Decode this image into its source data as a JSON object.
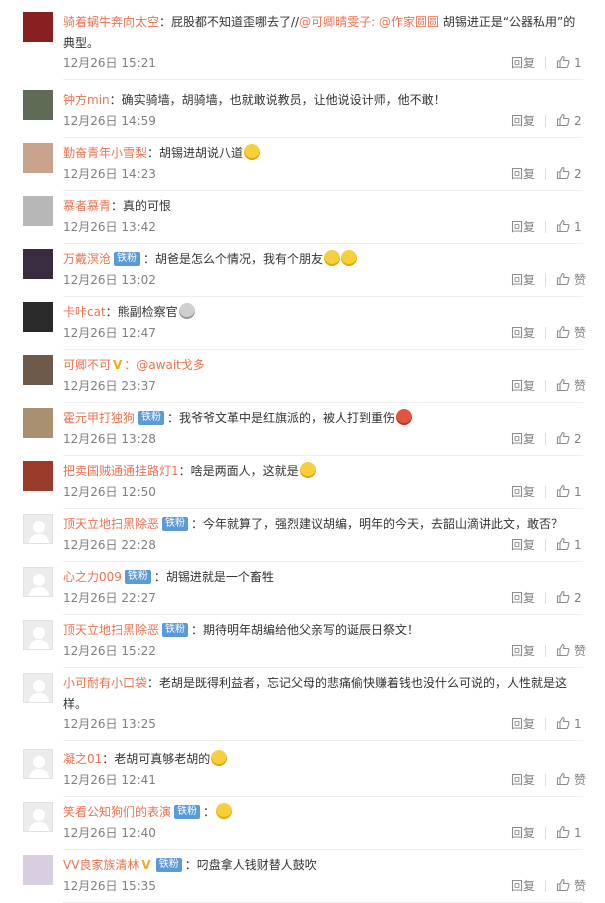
{
  "comments": [
    {
      "user": "骑着蜗牛奔向太空",
      "badge": "",
      "vip": "",
      "text_pre": "：屁股都不知道歪哪去了//",
      "mentions": [
        "@可卿晴雯子:",
        "@作家圆圆"
      ],
      "text": " 胡锡进正是“公器私用”的典型。",
      "emoji": "",
      "time": "12月26日 15:21",
      "reply": "回复",
      "likes": "1"
    },
    {
      "user": "钟方min",
      "badge": "",
      "vip": "",
      "text_pre": "",
      "mentions": [],
      "text": "：确实骑墙，胡骑墙，也就敢说教员，让他说设计师，他不敢！",
      "emoji": "",
      "time": "12月26日 14:59",
      "reply": "回复",
      "likes": "2"
    },
    {
      "user": "勤奋青年小雪梨",
      "badge": "",
      "vip": "",
      "text_pre": "",
      "mentions": [],
      "text": "：胡锡进胡说八道",
      "emoji": "tongue",
      "time": "12月26日 14:23",
      "reply": "回复",
      "likes": "2"
    },
    {
      "user": "慕者慕青",
      "badge": "",
      "vip": "",
      "text_pre": "",
      "mentions": [],
      "text": "：真的可恨",
      "emoji": "",
      "time": "12月26日 13:42",
      "reply": "回复",
      "likes": "1"
    },
    {
      "user": "万戴溟沧",
      "badge": "铁粉",
      "vip": "",
      "text_pre": "",
      "mentions": [],
      "text": "：胡爸是怎么个情况，我有个朋友",
      "emoji": "smile2",
      "time": "12月26日 13:02",
      "reply": "回复",
      "likes": "赞"
    },
    {
      "user": "卡咔cat",
      "badge": "",
      "vip": "",
      "text_pre": "",
      "mentions": [],
      "text": "：熊副检察官",
      "emoji": "panda",
      "time": "12月26日 12:47",
      "reply": "回复",
      "likes": "赞"
    },
    {
      "user": "可卿不可",
      "badge": "",
      "vip": "V",
      "text_pre": "",
      "mentions": [
        "：@await戈多"
      ],
      "text": "",
      "emoji": "",
      "time": "12月26日 23:37",
      "reply": "回复",
      "likes": "赞"
    },
    {
      "user": "霍元甲打独狗",
      "badge": "铁粉",
      "vip": "",
      "text_pre": "",
      "mentions": [],
      "text": "：我爷爷文革中是红旗派的，被人打到重伤",
      "emoji": "angry",
      "time": "12月26日 13:28",
      "reply": "回复",
      "likes": "2"
    },
    {
      "user": "把卖国贼通通挂路灯1",
      "badge": "",
      "vip": "",
      "text_pre": "",
      "mentions": [],
      "text": "：啥是两面人，这就是",
      "emoji": "lead",
      "time": "12月26日 12:50",
      "reply": "回复",
      "likes": "1"
    },
    {
      "user": "顶天立地扫黑除恶",
      "badge": "铁粉",
      "vip": "",
      "text_pre": "",
      "mentions": [],
      "text": "：今年就算了，强烈建议胡编，明年的今天，去韶山滴讲此文，敢否？",
      "emoji": "",
      "time": "12月26日 22:28",
      "reply": "回复",
      "likes": "1"
    },
    {
      "user": "心之力009",
      "badge": "铁粉",
      "vip": "",
      "text_pre": "",
      "mentions": [],
      "text": "：胡锡进就是一个畜牲",
      "emoji": "",
      "time": "12月26日 22:27",
      "reply": "回复",
      "likes": "2"
    },
    {
      "user": "顶天立地扫黑除恶",
      "badge": "铁粉",
      "vip": "",
      "text_pre": "",
      "mentions": [],
      "text": "：期待明年胡编给他父亲写的诞辰日祭文！",
      "emoji": "",
      "time": "12月26日 15:22",
      "reply": "回复",
      "likes": "赞"
    },
    {
      "user": "小可耐有小口袋",
      "badge": "",
      "vip": "",
      "text_pre": "",
      "mentions": [],
      "text": "：老胡是既得利益者，忘记父母的悲痛偷快赚着钱也没什么可说的，人性就是这样。",
      "emoji": "",
      "time": "12月26日 13:25",
      "reply": "回复",
      "likes": "1"
    },
    {
      "user": "凝之01",
      "badge": "",
      "vip": "",
      "text_pre": "",
      "mentions": [],
      "text": "：老胡可真够老胡的",
      "emoji": "cry",
      "time": "12月26日 12:41",
      "reply": "回复",
      "likes": "赞"
    },
    {
      "user": "笑看公知狗们的表演",
      "badge": "铁粉",
      "vip": "",
      "text_pre": "",
      "mentions": [],
      "text": "：",
      "emoji": "laugh",
      "time": "12月26日 12:40",
      "reply": "回复",
      "likes": "1"
    },
    {
      "user": "VV良家族清林",
      "badge": "铁粉",
      "vip": "V",
      "text_pre": "",
      "mentions": [],
      "text": "：叼盘拿人钱财替人鼓吹",
      "emoji": "",
      "time": "12月26日 15:35",
      "reply": "回复",
      "likes": "赞"
    }
  ],
  "avatar_colors": [
    "#8a1f1f",
    "#5f6b55",
    "#c9a38c",
    "#b7b7b7",
    "#3a2c3f",
    "#2a2a2a",
    "#6d5a4a",
    "#a89070",
    "#9a3a2a",
    "default",
    "default",
    "default",
    "default",
    "default",
    "default",
    "#d9cde0"
  ],
  "colors": {
    "username": "#eb7350",
    "badge": "#5a9ad6",
    "meta": "#808080"
  }
}
